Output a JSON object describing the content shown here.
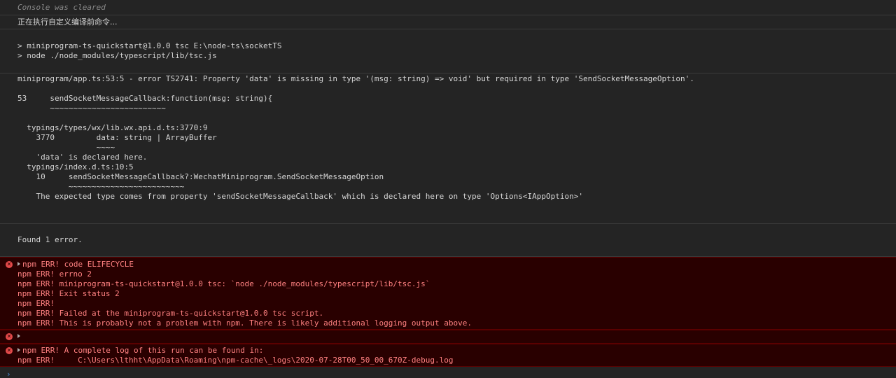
{
  "console": {
    "cleared_message": "Console was cleared",
    "info_message": "正在执行自定义编译前命令...",
    "command_lines": [
      "> miniprogram-ts-quickstart@1.0.0 tsc E:\\node-ts\\socketTS",
      "> node ./node_modules/typescript/lib/tsc.js"
    ],
    "tsc_output": [
      "miniprogram/app.ts:53:5 - error TS2741: Property 'data' is missing in type '(msg: string) => void' but required in type 'SendSocketMessageOption'.",
      "",
      "53     sendSocketMessageCallback:function(msg: string){",
      "       ~~~~~~~~~~~~~~~~~~~~~~~~~",
      "",
      "  typings/types/wx/lib.wx.api.d.ts:3770:9",
      "    3770         data: string | ArrayBuffer",
      "                 ~~~~",
      "    'data' is declared here.",
      "  typings/index.d.ts:10:5",
      "    10     sendSocketMessageCallback?:WechatMiniprogram.SendSocketMessageOption",
      "           ~~~~~~~~~~~~~~~~~~~~~~~~~",
      "    The expected type comes from property 'sendSocketMessageCallback' which is declared here on type 'Options<IAppOption>'"
    ],
    "found_message": "Found 1 error.",
    "errors": [
      {
        "lines": [
          "npm ERR! code ELIFECYCLE",
          "npm ERR! errno 2",
          "npm ERR! miniprogram-ts-quickstart@1.0.0 tsc: `node ./node_modules/typescript/lib/tsc.js`",
          "npm ERR! Exit status 2",
          "npm ERR!",
          "npm ERR! Failed at the miniprogram-ts-quickstart@1.0.0 tsc script.",
          "npm ERR! This is probably not a problem with npm. There is likely additional logging output above."
        ]
      },
      {
        "lines": [
          ""
        ]
      },
      {
        "lines": [
          "npm ERR! A complete log of this run can be found in:",
          "npm ERR!     C:\\Users\\lthht\\AppData\\Roaming\\npm-cache\\_logs\\2020-07-28T00_50_00_670Z-debug.log"
        ]
      }
    ],
    "error_icon_glyph": "✕",
    "error_color": "#ff8080",
    "error_background": "#290000",
    "prompt_glyph": "›",
    "icons": {
      "error": "error-circle-icon",
      "disclosure": "triangle-right-icon",
      "prompt": "prompt-chevron-icon"
    }
  }
}
